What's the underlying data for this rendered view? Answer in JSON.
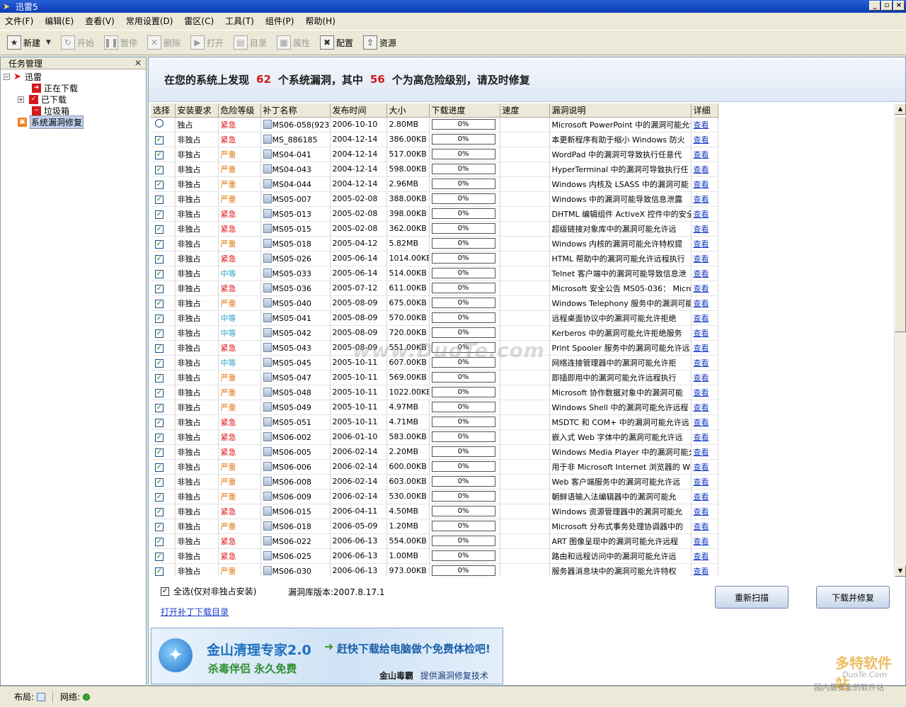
{
  "window": {
    "title": "迅雷5"
  },
  "menu": [
    "文件(F)",
    "编辑(E)",
    "查看(V)",
    "常用设置(D)",
    "雷区(C)",
    "工具(T)",
    "组件(P)",
    "帮助(H)"
  ],
  "toolbar": {
    "new": "新建",
    "start": "开始",
    "pause": "暂停",
    "delete": "删除",
    "open": "打开",
    "directory": "目录",
    "properties": "属性",
    "config": "配置",
    "resources": "资源"
  },
  "left_panel": {
    "header": "任务管理",
    "tree": {
      "root": "迅雷",
      "downloading": "正在下载",
      "downloaded": "已下载",
      "trash": "垃圾箱",
      "vuln_fix": "系统漏洞修复"
    }
  },
  "banner": {
    "prefix": "在您的系统上发现",
    "total": "62",
    "middle": "个系统漏洞，其中",
    "high": "56",
    "suffix": "个为高危险级别，请及时修复"
  },
  "table": {
    "headers": [
      "选择",
      "安装要求",
      "危险等级",
      "补丁名称",
      "发布时间",
      "大小",
      "下载进度",
      "速度",
      "漏洞说明",
      "详细"
    ],
    "rows": [
      {
        "sel": "radio",
        "req": "独占",
        "sev": "紧急",
        "sev_class": "urgent",
        "name": "MS06-058(9230",
        "date": "2006-10-10",
        "size": "2.80MB",
        "progress": "0%",
        "desc": "Microsoft PowerPoint 中的漏洞可能允许",
        "detail": "查看"
      },
      {
        "sel": "check",
        "req": "非独占",
        "sev": "紧急",
        "sev_class": "urgent",
        "name": "MS_886185",
        "date": "2004-12-14",
        "size": "386.00KB",
        "progress": "0%",
        "desc": "本更新程序有助于缩小 Windows 防火",
        "detail": "查看"
      },
      {
        "sel": "check",
        "req": "非独占",
        "sev": "严重",
        "sev_class": "severe",
        "name": "MS04-041",
        "date": "2004-12-14",
        "size": "517.00KB",
        "progress": "0%",
        "desc": "WordPad 中的漏洞可导致执行任意代",
        "detail": "查看"
      },
      {
        "sel": "check",
        "req": "非独占",
        "sev": "严重",
        "sev_class": "severe",
        "name": "MS04-043",
        "date": "2004-12-14",
        "size": "598.00KB",
        "progress": "0%",
        "desc": "HyperTerminal 中的漏洞可导致执行任",
        "detail": "查看"
      },
      {
        "sel": "check",
        "req": "非独占",
        "sev": "严重",
        "sev_class": "severe",
        "name": "MS04-044",
        "date": "2004-12-14",
        "size": "2.96MB",
        "progress": "0%",
        "desc": "Windows 内核及 LSASS 中的漏洞可能",
        "detail": "查看"
      },
      {
        "sel": "check",
        "req": "非独占",
        "sev": "严重",
        "sev_class": "severe",
        "name": "MS05-007",
        "date": "2005-02-08",
        "size": "388.00KB",
        "progress": "0%",
        "desc": "Windows 中的漏洞可能导致信息泄露",
        "detail": "查看"
      },
      {
        "sel": "check",
        "req": "非独占",
        "sev": "紧急",
        "sev_class": "urgent",
        "name": "MS05-013",
        "date": "2005-02-08",
        "size": "398.00KB",
        "progress": "0%",
        "desc": "DHTML 编辑组件 ActiveX 控件中的安全",
        "detail": "查看"
      },
      {
        "sel": "check",
        "req": "非独占",
        "sev": "紧急",
        "sev_class": "urgent",
        "name": "MS05-015",
        "date": "2005-02-08",
        "size": "362.00KB",
        "progress": "0%",
        "desc": "超级链接对象库中的漏洞可能允许远",
        "detail": "查看"
      },
      {
        "sel": "check",
        "req": "非独占",
        "sev": "严重",
        "sev_class": "severe",
        "name": "MS05-018",
        "date": "2005-04-12",
        "size": "5.82MB",
        "progress": "0%",
        "desc": "Windows 内核的漏洞可能允许特权提",
        "detail": "查看"
      },
      {
        "sel": "check",
        "req": "非独占",
        "sev": "紧急",
        "sev_class": "urgent",
        "name": "MS05-026",
        "date": "2005-06-14",
        "size": "1014.00KB",
        "progress": "0%",
        "desc": "HTML 帮助中的漏洞可能允许远程执行",
        "detail": "查看"
      },
      {
        "sel": "check",
        "req": "非独占",
        "sev": "中等",
        "sev_class": "medium",
        "name": "MS05-033",
        "date": "2005-06-14",
        "size": "514.00KB",
        "progress": "0%",
        "desc": "Telnet 客户端中的漏洞可能导致信息泄",
        "detail": "查看"
      },
      {
        "sel": "check",
        "req": "非独占",
        "sev": "紧急",
        "sev_class": "urgent",
        "name": "MS05-036",
        "date": "2005-07-12",
        "size": "611.00KB",
        "progress": "0%",
        "desc": "Microsoft 安全公告 MS05-036： Micros",
        "detail": "查看"
      },
      {
        "sel": "check",
        "req": "非独占",
        "sev": "严重",
        "sev_class": "severe",
        "name": "MS05-040",
        "date": "2005-08-09",
        "size": "675.00KB",
        "progress": "0%",
        "desc": "Windows Telephony 服务中的漏洞可能",
        "detail": "查看"
      },
      {
        "sel": "check",
        "req": "非独占",
        "sev": "中等",
        "sev_class": "medium",
        "name": "MS05-041",
        "date": "2005-08-09",
        "size": "570.00KB",
        "progress": "0%",
        "desc": "远程桌面协议中的漏洞可能允许拒绝",
        "detail": "查看"
      },
      {
        "sel": "check",
        "req": "非独占",
        "sev": "中等",
        "sev_class": "medium",
        "name": "MS05-042",
        "date": "2005-08-09",
        "size": "720.00KB",
        "progress": "0%",
        "desc": "Kerberos 中的漏洞可能允许拒绝服务",
        "detail": "查看"
      },
      {
        "sel": "check",
        "req": "非独占",
        "sev": "紧急",
        "sev_class": "urgent",
        "name": "MS05-043",
        "date": "2005-08-09",
        "size": "551.00KB",
        "progress": "0%",
        "desc": "Print Spooler 服务中的漏洞可能允许远",
        "detail": "查看"
      },
      {
        "sel": "check",
        "req": "非独占",
        "sev": "中等",
        "sev_class": "medium",
        "name": "MS05-045",
        "date": "2005-10-11",
        "size": "607.00KB",
        "progress": "0%",
        "desc": "网络连接管理器中的漏洞可能允许拒",
        "detail": "查看"
      },
      {
        "sel": "check",
        "req": "非独占",
        "sev": "严重",
        "sev_class": "severe",
        "name": "MS05-047",
        "date": "2005-10-11",
        "size": "569.00KB",
        "progress": "0%",
        "desc": "即插即用中的漏洞可能允许远程执行",
        "detail": "查看"
      },
      {
        "sel": "check",
        "req": "非独占",
        "sev": "严重",
        "sev_class": "severe",
        "name": "MS05-048",
        "date": "2005-10-11",
        "size": "1022.00KB",
        "progress": "0%",
        "desc": "Microsoft 协作数据对象中的漏洞可能",
        "detail": "查看"
      },
      {
        "sel": "check",
        "req": "非独占",
        "sev": "严重",
        "sev_class": "severe",
        "name": "MS05-049",
        "date": "2005-10-11",
        "size": "4.97MB",
        "progress": "0%",
        "desc": "Windows Shell 中的漏洞可能允许远程",
        "detail": "查看"
      },
      {
        "sel": "check",
        "req": "非独占",
        "sev": "紧急",
        "sev_class": "urgent",
        "name": "MS05-051",
        "date": "2005-10-11",
        "size": "4.71MB",
        "progress": "0%",
        "desc": "MSDTC 和 COM+ 中的漏洞可能允许远",
        "detail": "查看"
      },
      {
        "sel": "check",
        "req": "非独占",
        "sev": "紧急",
        "sev_class": "urgent",
        "name": "MS06-002",
        "date": "2006-01-10",
        "size": "583.00KB",
        "progress": "0%",
        "desc": "嵌入式 Web 字体中的漏洞可能允许远",
        "detail": "查看"
      },
      {
        "sel": "check",
        "req": "非独占",
        "sev": "紧急",
        "sev_class": "urgent",
        "name": "MS06-005",
        "date": "2006-02-14",
        "size": "2.20MB",
        "progress": "0%",
        "desc": "Windows Media Player 中的漏洞可能允",
        "detail": "查看"
      },
      {
        "sel": "check",
        "req": "非独占",
        "sev": "严重",
        "sev_class": "severe",
        "name": "MS06-006",
        "date": "2006-02-14",
        "size": "600.00KB",
        "progress": "0%",
        "desc": "用于非 Microsoft Internet 浏览器的 Wi",
        "detail": "查看"
      },
      {
        "sel": "check",
        "req": "非独占",
        "sev": "严重",
        "sev_class": "severe",
        "name": "MS06-008",
        "date": "2006-02-14",
        "size": "603.00KB",
        "progress": "0%",
        "desc": "Web 客户端服务中的漏洞可能允许远",
        "detail": "查看"
      },
      {
        "sel": "check",
        "req": "非独占",
        "sev": "严重",
        "sev_class": "severe",
        "name": "MS06-009",
        "date": "2006-02-14",
        "size": "530.00KB",
        "progress": "0%",
        "desc": "朝鲜语输入法编辑器中的漏洞可能允",
        "detail": "查看"
      },
      {
        "sel": "check",
        "req": "非独占",
        "sev": "紧急",
        "sev_class": "urgent",
        "name": "MS06-015",
        "date": "2006-04-11",
        "size": "4.50MB",
        "progress": "0%",
        "desc": "Windows 资源管理器中的漏洞可能允",
        "detail": "查看"
      },
      {
        "sel": "check",
        "req": "非独占",
        "sev": "严重",
        "sev_class": "severe",
        "name": "MS06-018",
        "date": "2006-05-09",
        "size": "1.20MB",
        "progress": "0%",
        "desc": "Microsoft 分布式事务处理协调器中的",
        "detail": "查看"
      },
      {
        "sel": "check",
        "req": "非独占",
        "sev": "紧急",
        "sev_class": "urgent",
        "name": "MS06-022",
        "date": "2006-06-13",
        "size": "554.00KB",
        "progress": "0%",
        "desc": "ART 图像呈现中的漏洞可能允许远程",
        "detail": "查看"
      },
      {
        "sel": "check",
        "req": "非独占",
        "sev": "紧急",
        "sev_class": "urgent",
        "name": "MS06-025",
        "date": "2006-06-13",
        "size": "1.00MB",
        "progress": "0%",
        "desc": "路由和远程访问中的漏洞可能允许远",
        "detail": "查看"
      },
      {
        "sel": "check",
        "req": "非独占",
        "sev": "严重",
        "sev_class": "severe",
        "name": "MS06-030",
        "date": "2006-06-13",
        "size": "973.00KB",
        "progress": "0%",
        "desc": "服务器消息块中的漏洞可能允许特权",
        "detail": "查看"
      }
    ]
  },
  "bottom": {
    "select_all": "全选(仅对非独占安装)",
    "db_version": "漏洞库版本:2007.8.17.1",
    "open_dir": "打开补丁下载目录",
    "rescan": "重新扫描",
    "download_fix": "下载并修复"
  },
  "ad": {
    "title": "金山清理专家2.0",
    "subtitle": "杀毒伴侣  永久免费",
    "slogan": "赶快下载给电脑做个免费体检吧!",
    "brand": "金山毒霸",
    "footer": "提供漏洞修复技术"
  },
  "statusbar": {
    "layout": "布局:",
    "network": "网络:"
  },
  "watermarks": {
    "center": "www.DuoTe.com",
    "corner_a": "多特软件站",
    "corner_b": "DuoTe.Com",
    "corner_c": "国内最安全的软件站"
  }
}
